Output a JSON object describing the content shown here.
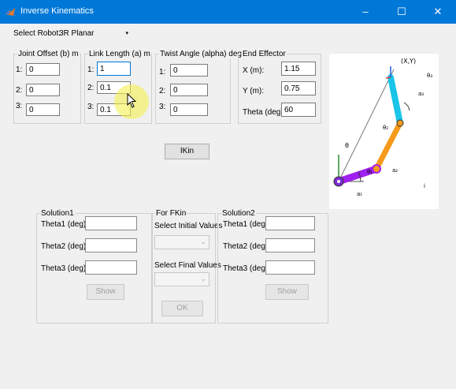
{
  "window": {
    "title": "Inverse Kinematics",
    "min": "–",
    "max": "☐",
    "close": "✕"
  },
  "robot": {
    "label": "Select Robot:",
    "value": "3R Planar",
    "arrow": "▾"
  },
  "joint_offset": {
    "title": "Joint Offset (b) m",
    "rows": [
      {
        "label": "1:",
        "value": "0"
      },
      {
        "label": "2:",
        "value": "0"
      },
      {
        "label": "3:",
        "value": "0"
      }
    ]
  },
  "link_length": {
    "title": "Link Length (a) m",
    "rows": [
      {
        "label": "1:",
        "value": "1"
      },
      {
        "label": "2:",
        "value": "0.1"
      },
      {
        "label": "3:",
        "value": "0.1"
      }
    ]
  },
  "twist_angle": {
    "title": "Twist Angle (alpha) deg",
    "rows": [
      {
        "label": "1:",
        "value": "0"
      },
      {
        "label": "2:",
        "value": "0"
      },
      {
        "label": "3:",
        "value": "0"
      }
    ]
  },
  "end_effector": {
    "title": "End Effector",
    "x": {
      "label": "X (m):",
      "value": "1.15"
    },
    "y": {
      "label": "Y (m):",
      "value": "0.75"
    },
    "theta": {
      "label": "Theta (deg):",
      "value": "60"
    }
  },
  "ikin_button": "IKin",
  "solution1": {
    "title": "Solution1",
    "t1": "Theta1 (deg):",
    "t2": "Theta2 (deg):",
    "t3": "Theta3 (deg):",
    "show": "Show"
  },
  "fkin": {
    "title": "For FKin",
    "initial": "Select Initial Values",
    "final": "Select Final Values",
    "ok": "OK",
    "arrow": "⌄"
  },
  "solution2": {
    "title": "Solution2",
    "t1": "Theta1 (deg):",
    "t2": "Theta2 (deg):",
    "t3": "Theta3 (deg):",
    "show": "Show"
  },
  "diagram": {
    "xy": "(X,Y)",
    "theta": "θ",
    "th1": "θ₁",
    "th2": "θ₂",
    "th3": "θ₃",
    "a1": "a₁",
    "a2": "a₂",
    "a3": "a₃",
    "i": "i"
  },
  "colors": {
    "titlebar": "#0078d7",
    "link1": "#a020f0",
    "link2": "#f59a1a",
    "link3": "#19c5e8",
    "highlight": "#f5f050"
  }
}
